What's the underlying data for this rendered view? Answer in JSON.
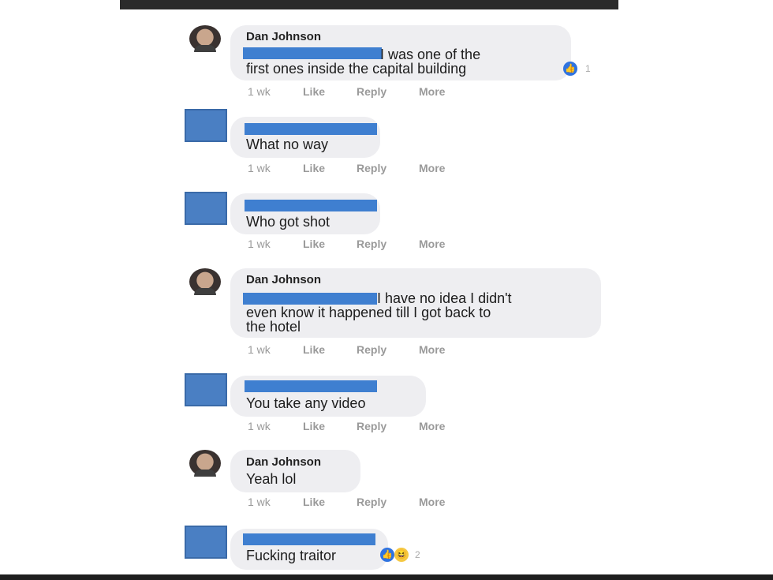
{
  "comments": [
    {
      "author": "Dan Johnson",
      "lines": [
        "I was one of the",
        "first ones inside the capital building"
      ],
      "time": "1 wk",
      "like": "Like",
      "reply": "Reply",
      "more": "More",
      "reaction_icon": "like-icon",
      "reaction_count": "1"
    },
    {
      "author": "",
      "lines": [
        "What no way"
      ],
      "time": "1 wk",
      "like": "Like",
      "reply": "Reply",
      "more": "More"
    },
    {
      "author": "",
      "lines": [
        "Who got shot"
      ],
      "time": "1 wk",
      "like": "Like",
      "reply": "Reply",
      "more": "More"
    },
    {
      "author": "Dan Johnson",
      "lines": [
        "I have no idea I didn't",
        "even know it happened till I got back to",
        "the hotel"
      ],
      "time": "1 wk",
      "like": "Like",
      "reply": "Reply",
      "more": "More"
    },
    {
      "author": "",
      "lines": [
        "You take any video"
      ],
      "time": "1 wk",
      "like": "Like",
      "reply": "Reply",
      "more": "More"
    },
    {
      "author": "Dan Johnson",
      "lines": [
        "Yeah lol"
      ],
      "time": "1 wk",
      "like": "Like",
      "reply": "Reply",
      "more": "More"
    },
    {
      "author": "",
      "lines": [
        "Fucking traitor"
      ],
      "reaction_icons": [
        "like-icon",
        "haha-icon"
      ],
      "reaction_count": "2"
    }
  ],
  "colors": {
    "redaction": "#3f7fd0",
    "avatar_placeholder": "#4a7fc3",
    "bubble": "#eeeef1",
    "like": "#2f73e0"
  }
}
